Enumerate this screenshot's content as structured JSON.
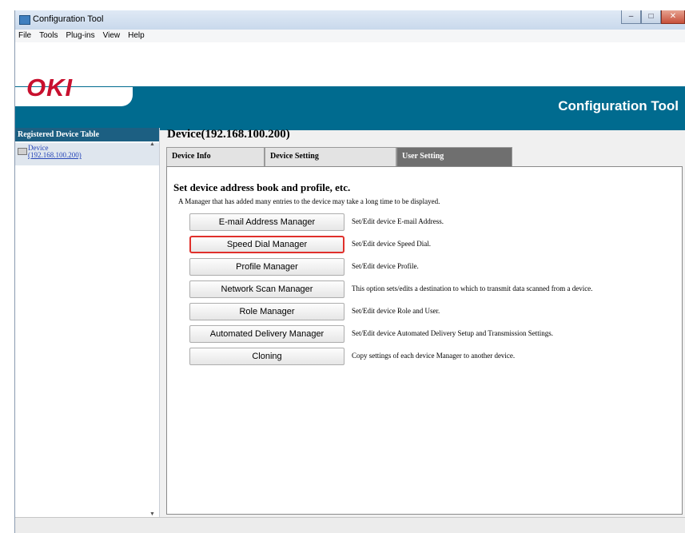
{
  "window": {
    "title": "Configuration Tool",
    "controls": [
      "–",
      "□",
      "✕"
    ]
  },
  "menu": [
    "File",
    "Tools",
    "Plug-ins",
    "View",
    "Help"
  ],
  "header": {
    "logo_text": "OKI",
    "brand_title": "Configuration Tool"
  },
  "sidebar": {
    "title": "Registered Device Table",
    "device": {
      "name": "Device",
      "ip": "(192.168.100.200)"
    }
  },
  "main": {
    "device_title": "Device(192.168.100.200)",
    "tabs": [
      {
        "label": "Device Info",
        "active": false
      },
      {
        "label": "Device Setting",
        "active": false
      },
      {
        "label": "User Setting",
        "active": true
      }
    ],
    "heading": "Set device address book and profile, etc.",
    "subheading": "A Manager that has added many entries to the device may take a long time to be displayed.",
    "managers": [
      {
        "label": "E-mail Address Manager",
        "description": "Set/Edit device E-mail Address.",
        "highlighted": false
      },
      {
        "label": "Speed Dial Manager",
        "description": "Set/Edit device Speed Dial.",
        "highlighted": true
      },
      {
        "label": "Profile Manager",
        "description": "Set/Edit device Profile.",
        "highlighted": false
      },
      {
        "label": "Network Scan Manager",
        "description": "This option sets/edits a destination to which to transmit data scanned from a device.",
        "highlighted": false
      },
      {
        "label": "Role Manager",
        "description": "Set/Edit device Role and User.",
        "highlighted": false
      },
      {
        "label": "Automated Delivery Manager",
        "description": "Set/Edit device Automated Delivery Setup and Transmission Settings.",
        "highlighted": false
      },
      {
        "label": "Cloning",
        "description": "Copy settings of each device Manager to another device.",
        "highlighted": false
      }
    ]
  },
  "colors": {
    "brand_teal": "#006b8f",
    "sidebar_header": "#1c5f82",
    "logo_red": "#c8102e",
    "highlight_red": "#e0302b",
    "active_tab": "#6f6f6f"
  }
}
